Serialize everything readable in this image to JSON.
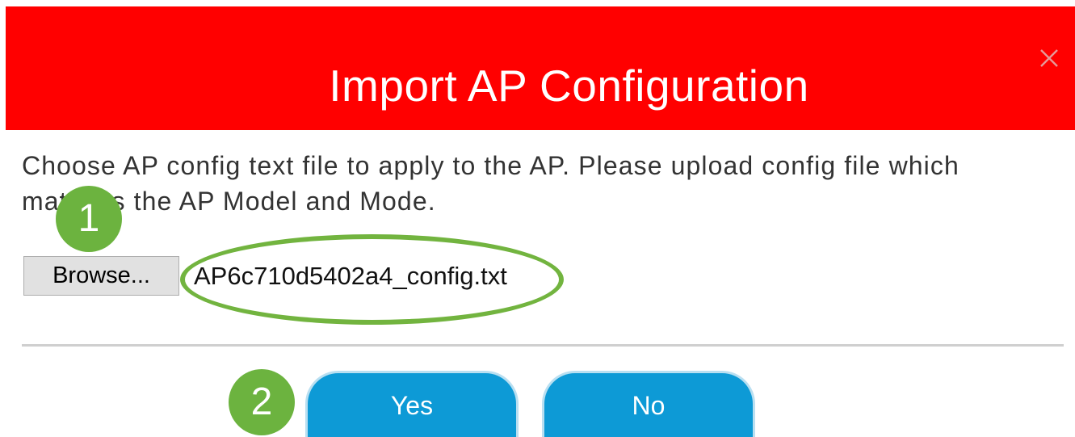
{
  "dialog": {
    "title": "Import AP Configuration",
    "message": "Choose AP config text file to apply to the AP. Please upload config file which matches the AP Model and Mode.",
    "browse_label": "Browse...",
    "selected_file": "AP6c710d5402a4_config.txt",
    "yes_label": "Yes",
    "no_label": "No"
  },
  "annotations": {
    "step_1": "1",
    "step_2": "2"
  },
  "colors": {
    "header": "#ff0000",
    "button": "#0d9ad6",
    "annotation": "#6cb33f"
  },
  "icons": {
    "close": "close-icon"
  }
}
